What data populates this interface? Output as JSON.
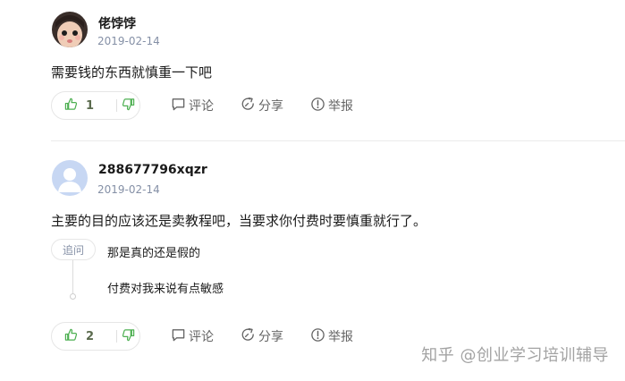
{
  "comments": [
    {
      "author": "佬饽饽",
      "date": "2019-02-14",
      "content": "需要钱的东西就慎重一下吧",
      "likes": "1",
      "actions": {
        "comment": "评论",
        "share": "分享",
        "report": "举报"
      }
    },
    {
      "author": "288677796xqzr",
      "date": "2019-02-14",
      "content": "主要的目的应该还是卖教程吧，当要求你付费时要慎重就行了。",
      "followup": {
        "tag": "追问",
        "question": "那是真的还是假的",
        "reply": "付费对我来说有点敏感"
      },
      "likes": "2",
      "actions": {
        "comment": "评论",
        "share": "分享",
        "report": "举报"
      }
    }
  ],
  "watermark": "知乎 @创业学习培训辅导",
  "colors": {
    "like_green": "#4caf50",
    "muted": "#8590a6",
    "action_gray": "#646464"
  }
}
